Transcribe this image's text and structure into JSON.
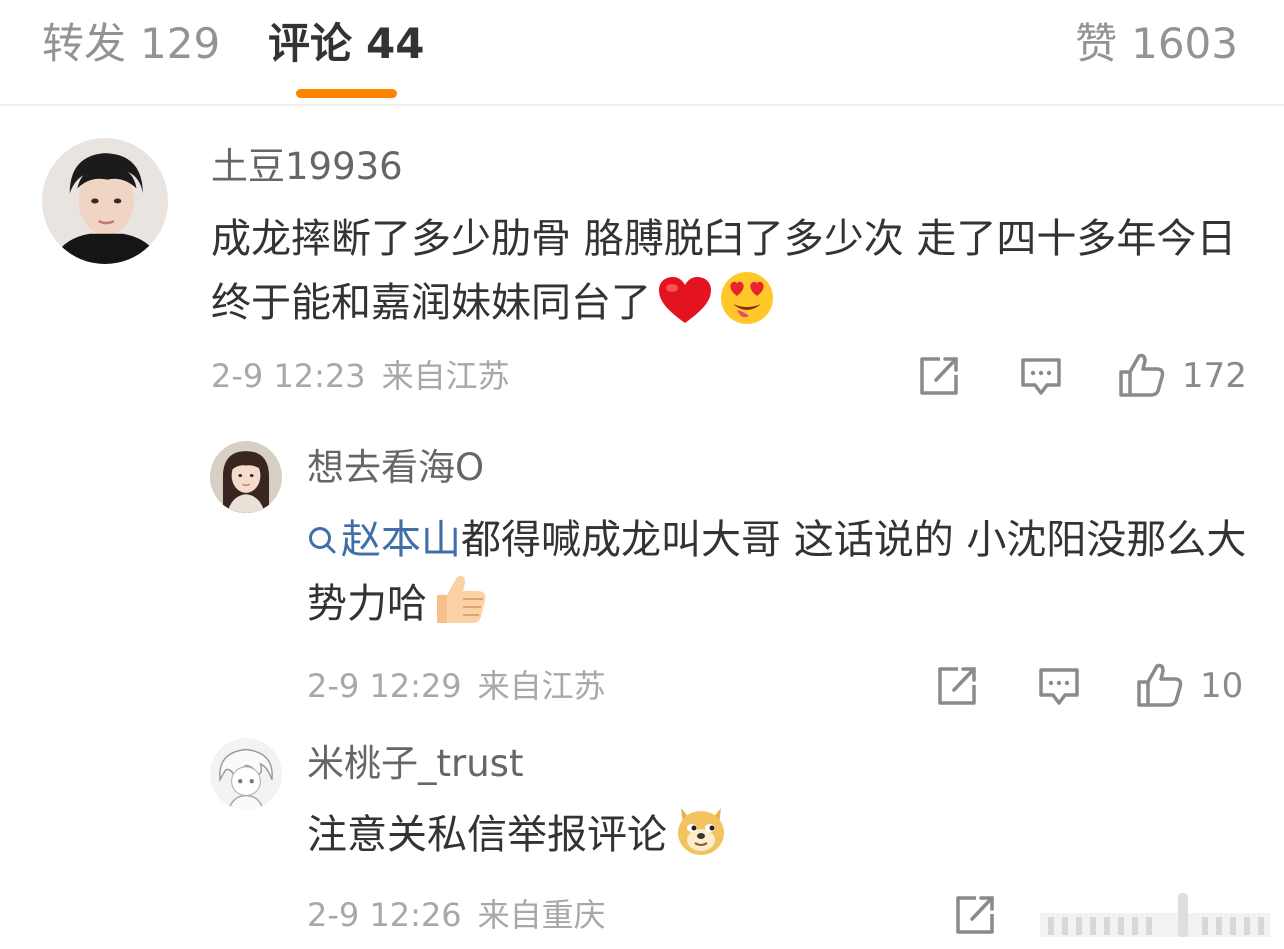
{
  "tabs": {
    "repost_label": "转发",
    "repost_count": "129",
    "comment_label": "评论",
    "comment_count": "44",
    "like_label": "赞",
    "like_count": "1603",
    "active_color": "#ff8200"
  },
  "comments": [
    {
      "username": "土豆19936",
      "text": "成龙摔断了多少肋骨 胳膊脱臼了多少次 走了四十多年今日终于能和嘉润妹妹同台了",
      "emojis": [
        "red-heart-icon",
        "heart-eyes-face-icon"
      ],
      "time": "2-9 12:23",
      "location": "来自江苏",
      "likes": "172"
    },
    {
      "username": "想去看海O",
      "mention": "赵本山",
      "text": "都得喊成龙叫大哥 这话说的 小沈阳没那么大势力哈",
      "emojis": [
        "thumbs-up-icon"
      ],
      "time": "2-9 12:29",
      "location": "来自江苏",
      "likes": "10"
    },
    {
      "username": "米桃子_trust",
      "text": "注意关私信举报评论",
      "emojis": [
        "doge-icon"
      ],
      "time": "2-9 12:26",
      "location": "来自重庆",
      "likes": ""
    }
  ],
  "colors": {
    "accent": "#ff8200",
    "link": "#3f6ea8",
    "meta": "#a8a8a8"
  }
}
